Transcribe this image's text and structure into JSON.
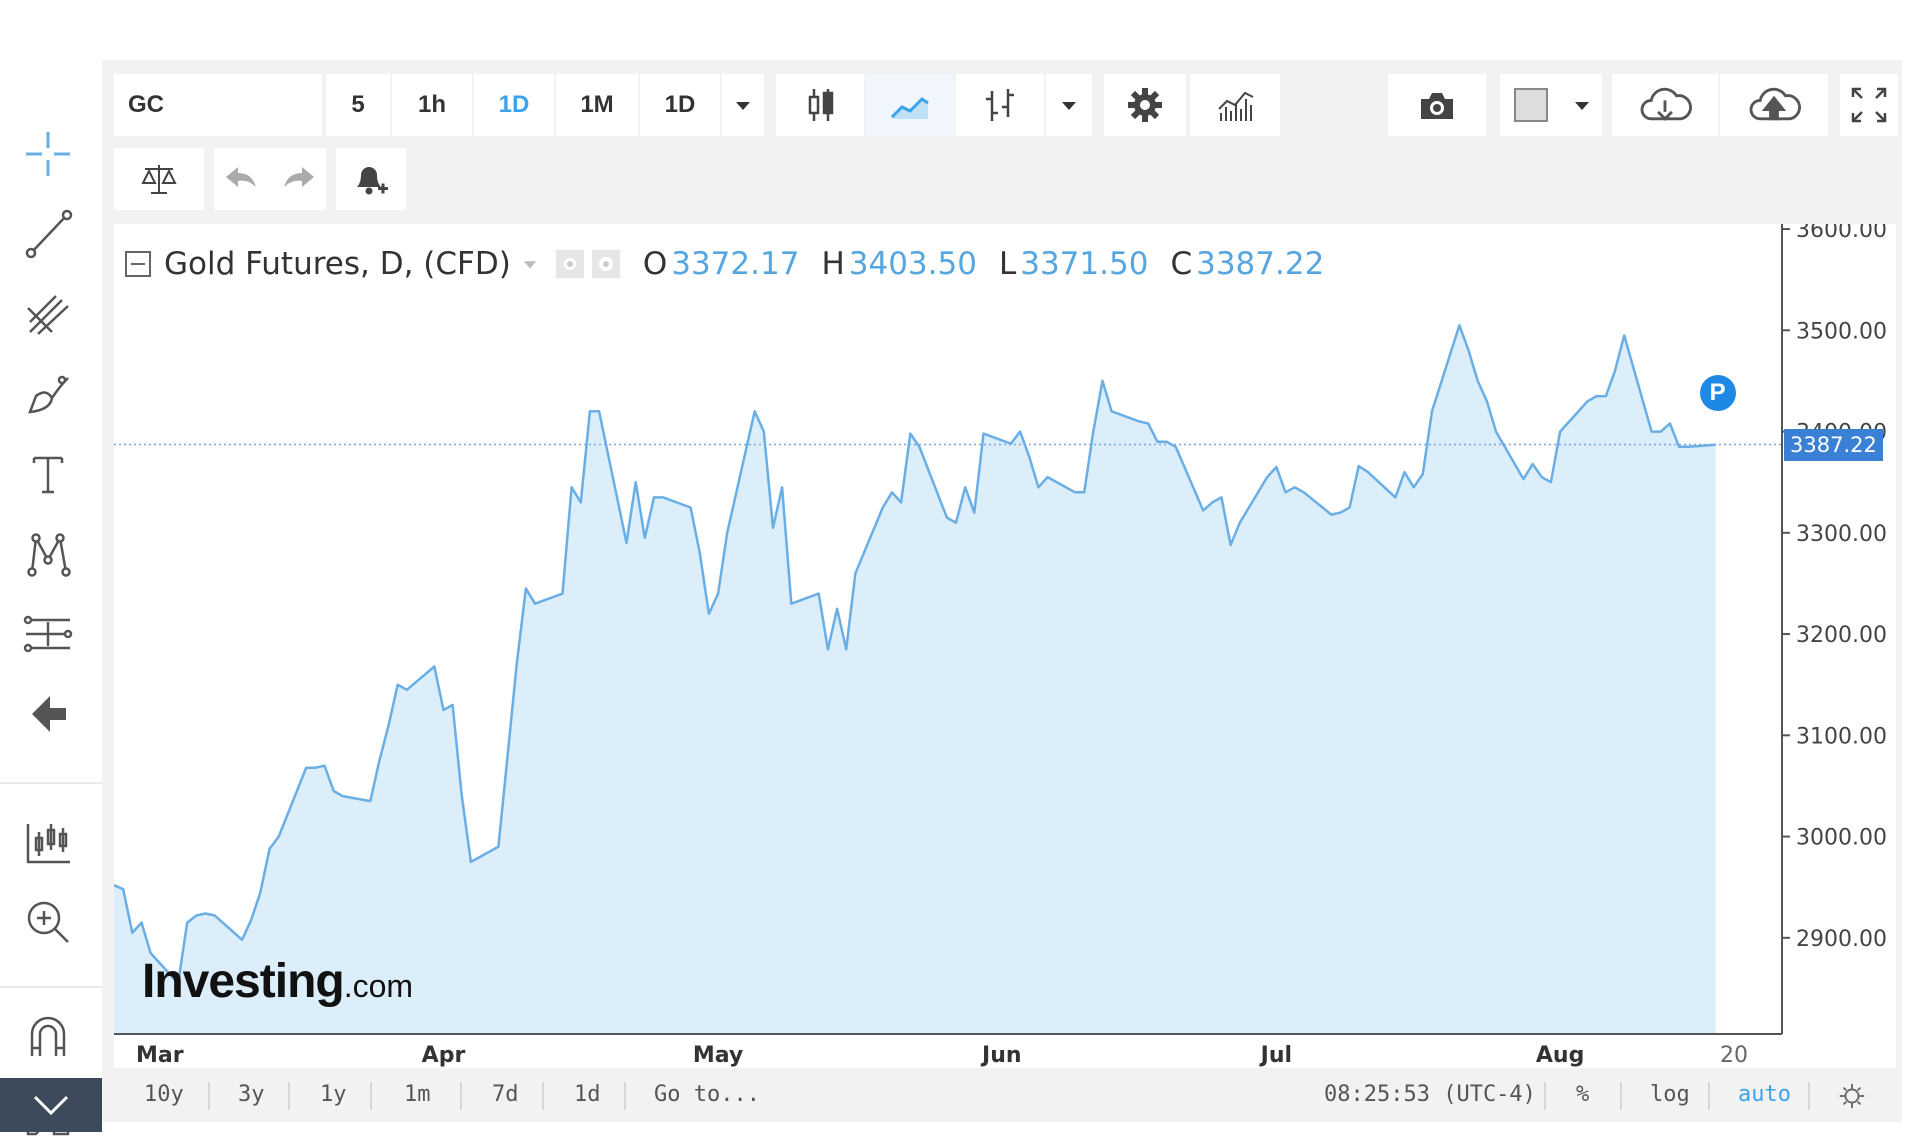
{
  "toolbar": {
    "symbol": "GC",
    "intervals": [
      "5",
      "1h",
      "1D",
      "1M",
      "1D"
    ],
    "active_interval_index": 2
  },
  "legend": {
    "title": "Gold Futures, D, (CFD)",
    "o_label": "O",
    "o_value": "3372.17",
    "h_label": "H",
    "h_value": "3403.50",
    "l_label": "L",
    "l_value": "3371.50",
    "c_label": "C",
    "c_value": "3387.22"
  },
  "watermark": {
    "brand": "Investing",
    "suffix": ".com"
  },
  "marker": {
    "label": "P"
  },
  "bottom_bar": {
    "ranges": [
      "10y",
      "3y",
      "1y",
      "1m",
      "7d",
      "1d"
    ],
    "goto": "Go to...",
    "time": "08:25:53 (UTC-4)",
    "percent": "%",
    "log": "log",
    "auto": "auto"
  },
  "colors": {
    "line": "#6aaee6",
    "area": "#dceefa",
    "accent": "#3da3e8",
    "price_tag": "#3a80d4",
    "marker": "#1e88e5"
  },
  "chart_data": {
    "type": "area",
    "title": "Gold Futures, D, (CFD)",
    "xlabel": "",
    "ylabel": "",
    "x_start": "2025-02-24",
    "x_end": "2025-08-20",
    "x_ticks": [
      {
        "label": "Mar",
        "date": "2025-03-01"
      },
      {
        "label": "Apr",
        "date": "2025-04-01"
      },
      {
        "label": "May",
        "date": "2025-05-01"
      },
      {
        "label": "Jun",
        "date": "2025-06-01"
      },
      {
        "label": "Jul",
        "date": "2025-07-01"
      },
      {
        "label": "Aug",
        "date": "2025-08-01"
      },
      {
        "label": "20",
        "date": "2025-08-20"
      }
    ],
    "y_ticks": [
      2900,
      3000,
      3100,
      3200,
      3300,
      3400,
      3500,
      3600
    ],
    "y_tick_labels": [
      "2900.00",
      "3000.00",
      "3100.00",
      "3200.00",
      "3300.00",
      "3400.00",
      "3500.00",
      "3600.00"
    ],
    "ylim": [
      2805,
      3605
    ],
    "grid": false,
    "last_price": 3387.22,
    "last_price_label": "3387.22",
    "series": [
      {
        "points": [
          [
            "2025-02-24",
            2952
          ],
          [
            "2025-02-25",
            2948
          ],
          [
            "2025-02-26",
            2905
          ],
          [
            "2025-02-27",
            2915
          ],
          [
            "2025-02-28",
            2885
          ],
          [
            "2025-03-03",
            2855
          ],
          [
            "2025-03-04",
            2915
          ],
          [
            "2025-03-05",
            2922
          ],
          [
            "2025-03-06",
            2924
          ],
          [
            "2025-03-07",
            2922
          ],
          [
            "2025-03-10",
            2898
          ],
          [
            "2025-03-11",
            2918
          ],
          [
            "2025-03-12",
            2945
          ],
          [
            "2025-03-13",
            2988
          ],
          [
            "2025-03-14",
            3000
          ],
          [
            "2025-03-17",
            3068
          ],
          [
            "2025-03-18",
            3068
          ],
          [
            "2025-03-19",
            3070
          ],
          [
            "2025-03-20",
            3045
          ],
          [
            "2025-03-21",
            3040
          ],
          [
            "2025-03-24",
            3035
          ],
          [
            "2025-03-25",
            3075
          ],
          [
            "2025-03-26",
            3110
          ],
          [
            "2025-03-27",
            3150
          ],
          [
            "2025-03-28",
            3145
          ],
          [
            "2025-03-31",
            3168
          ],
          [
            "2025-04-01",
            3125
          ],
          [
            "2025-04-02",
            3130
          ],
          [
            "2025-04-03",
            3040
          ],
          [
            "2025-04-04",
            2975
          ],
          [
            "2025-04-07",
            2990
          ],
          [
            "2025-04-08",
            3080
          ],
          [
            "2025-04-09",
            3170
          ],
          [
            "2025-04-10",
            3245
          ],
          [
            "2025-04-11",
            3230
          ],
          [
            "2025-04-14",
            3240
          ],
          [
            "2025-04-15",
            3345
          ],
          [
            "2025-04-16",
            3330
          ],
          [
            "2025-04-17",
            3420
          ],
          [
            "2025-04-18",
            3420
          ],
          [
            "2025-04-21",
            3290
          ],
          [
            "2025-04-22",
            3350
          ],
          [
            "2025-04-23",
            3295
          ],
          [
            "2025-04-24",
            3335
          ],
          [
            "2025-04-25",
            3335
          ],
          [
            "2025-04-28",
            3325
          ],
          [
            "2025-04-29",
            3280
          ],
          [
            "2025-04-30",
            3220
          ],
          [
            "2025-05-01",
            3240
          ],
          [
            "2025-05-02",
            3300
          ],
          [
            "2025-05-05",
            3420
          ],
          [
            "2025-05-06",
            3400
          ],
          [
            "2025-05-07",
            3305
          ],
          [
            "2025-05-08",
            3345
          ],
          [
            "2025-05-09",
            3230
          ],
          [
            "2025-05-12",
            3240
          ],
          [
            "2025-05-13",
            3185
          ],
          [
            "2025-05-14",
            3225
          ],
          [
            "2025-05-15",
            3185
          ],
          [
            "2025-05-16",
            3260
          ],
          [
            "2025-05-19",
            3325
          ],
          [
            "2025-05-20",
            3340
          ],
          [
            "2025-05-21",
            3330
          ],
          [
            "2025-05-22",
            3398
          ],
          [
            "2025-05-23",
            3385
          ],
          [
            "2025-05-26",
            3315
          ],
          [
            "2025-05-27",
            3310
          ],
          [
            "2025-05-28",
            3345
          ],
          [
            "2025-05-29",
            3320
          ],
          [
            "2025-05-30",
            3398
          ],
          [
            "2025-06-02",
            3388
          ],
          [
            "2025-06-03",
            3400
          ],
          [
            "2025-06-04",
            3375
          ],
          [
            "2025-06-05",
            3345
          ],
          [
            "2025-06-06",
            3355
          ],
          [
            "2025-06-09",
            3340
          ],
          [
            "2025-06-10",
            3340
          ],
          [
            "2025-06-11",
            3400
          ],
          [
            "2025-06-12",
            3450
          ],
          [
            "2025-06-13",
            3420
          ],
          [
            "2025-06-16",
            3410
          ],
          [
            "2025-06-17",
            3408
          ],
          [
            "2025-06-18",
            3390
          ],
          [
            "2025-06-19",
            3390
          ],
          [
            "2025-06-20",
            3385
          ],
          [
            "2025-06-23",
            3322
          ],
          [
            "2025-06-24",
            3330
          ],
          [
            "2025-06-25",
            3335
          ],
          [
            "2025-06-26",
            3288
          ],
          [
            "2025-06-27",
            3310
          ],
          [
            "2025-06-30",
            3355
          ],
          [
            "2025-07-01",
            3365
          ],
          [
            "2025-07-02",
            3340
          ],
          [
            "2025-07-03",
            3345
          ],
          [
            "2025-07-04",
            3340
          ],
          [
            "2025-07-07",
            3318
          ],
          [
            "2025-07-08",
            3320
          ],
          [
            "2025-07-09",
            3325
          ],
          [
            "2025-07-10",
            3366
          ],
          [
            "2025-07-11",
            3360
          ],
          [
            "2025-07-14",
            3335
          ],
          [
            "2025-07-15",
            3360
          ],
          [
            "2025-07-16",
            3345
          ],
          [
            "2025-07-17",
            3358
          ],
          [
            "2025-07-18",
            3420
          ],
          [
            "2025-07-21",
            3505
          ],
          [
            "2025-07-22",
            3480
          ],
          [
            "2025-07-23",
            3450
          ],
          [
            "2025-07-24",
            3430
          ],
          [
            "2025-07-25",
            3400
          ],
          [
            "2025-07-28",
            3353
          ],
          [
            "2025-07-29",
            3368
          ],
          [
            "2025-07-30",
            3355
          ],
          [
            "2025-07-31",
            3350
          ],
          [
            "2025-08-01",
            3400
          ],
          [
            "2025-08-04",
            3430
          ],
          [
            "2025-08-05",
            3435
          ],
          [
            "2025-08-06",
            3435
          ],
          [
            "2025-08-07",
            3460
          ],
          [
            "2025-08-08",
            3495
          ],
          [
            "2025-08-11",
            3400
          ],
          [
            "2025-08-12",
            3400
          ],
          [
            "2025-08-13",
            3408
          ],
          [
            "2025-08-14",
            3385
          ],
          [
            "2025-08-15",
            3385
          ],
          [
            "2025-08-18",
            3387
          ]
        ]
      }
    ]
  }
}
